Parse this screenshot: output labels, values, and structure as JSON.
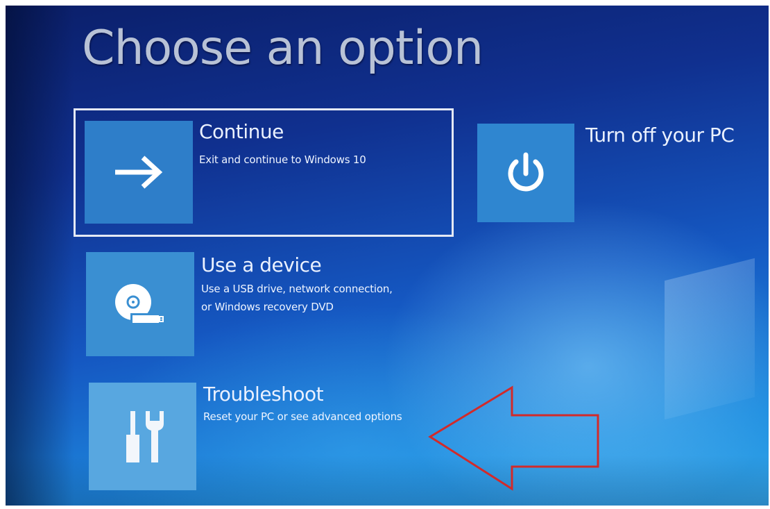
{
  "page": {
    "title": "Choose an option"
  },
  "options": {
    "continue": {
      "title": "Continue",
      "description": "Exit and continue to Windows 10",
      "icon": "arrow-right-icon",
      "selected": true
    },
    "turn_off": {
      "title": "Turn off your PC",
      "icon": "power-icon"
    },
    "use_device": {
      "title": "Use a device",
      "description_lines": [
        "Use a USB drive, network connection,",
        "or Windows recovery DVD"
      ],
      "icon": "disc-usb-icon"
    },
    "troubleshoot": {
      "title": "Troubleshoot",
      "description": "Reset your PC or see advanced options",
      "icon": "tools-icon"
    }
  },
  "annotation": {
    "icon": "red-outline-arrow-left-icon",
    "color": "#d22a2a"
  },
  "colors": {
    "background_top": "#0b1f6a",
    "background_bottom": "#36a8ea",
    "tile_blue": "#2e7ec9",
    "text": "#eaf1ff"
  }
}
